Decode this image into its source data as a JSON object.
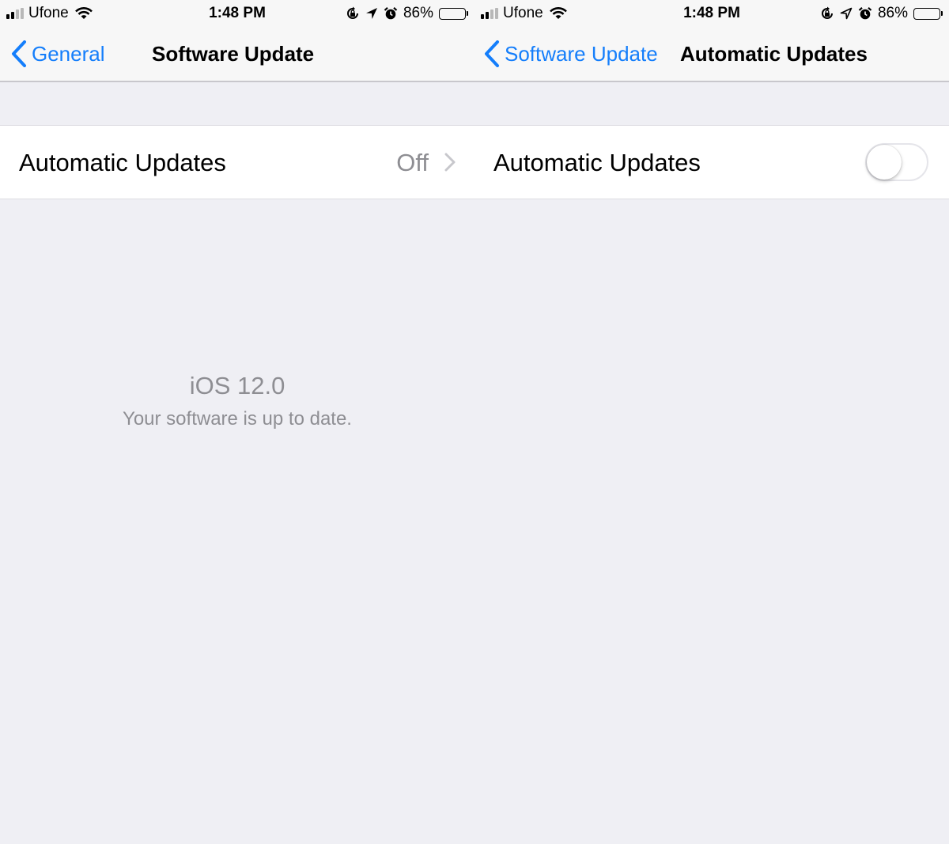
{
  "colors": {
    "accent": "#147efb",
    "secondary_text": "#8e8e93",
    "background": "#efeff4"
  },
  "left_screen": {
    "status_bar": {
      "carrier": "Ufone",
      "time": "1:48 PM",
      "battery": "86%",
      "battery_level": 0.86
    },
    "nav": {
      "back_label": "General",
      "title": "Software Update"
    },
    "row": {
      "label": "Automatic Updates",
      "value": "Off"
    },
    "info": {
      "version": "iOS 12.0",
      "status": "Your software is up to date."
    }
  },
  "right_screen": {
    "status_bar": {
      "carrier": "Ufone",
      "time": "1:48 PM",
      "battery": "86%",
      "battery_level": 0.86
    },
    "nav": {
      "back_label": "Software Update",
      "title": "Automatic Updates"
    },
    "row": {
      "label": "Automatic Updates",
      "toggle_on": false
    }
  }
}
